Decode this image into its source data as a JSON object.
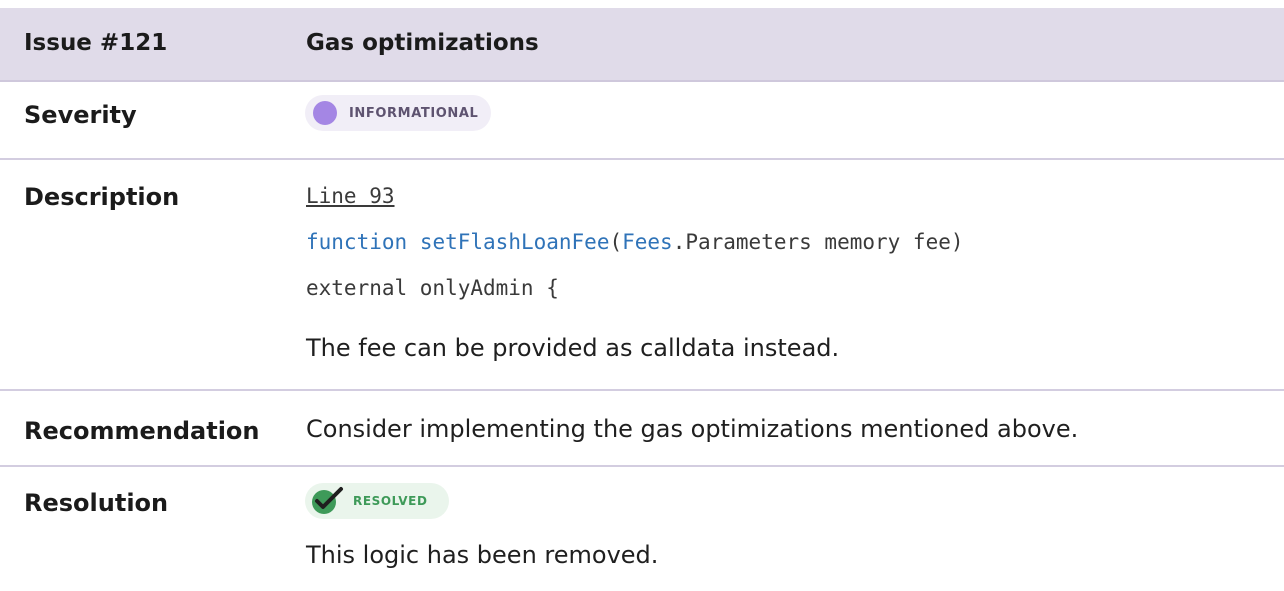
{
  "issue": {
    "number_label": "Issue #121",
    "title": "Gas optimizations"
  },
  "rows": {
    "severity": {
      "label": "Severity",
      "badge": "INFORMATIONAL",
      "badge_color": "#a486e4"
    },
    "description": {
      "label": "Description",
      "line_ref": "Line 93",
      "code_line1": {
        "keyword": "function",
        "space": " ",
        "name": "setFlashLoanFee",
        "open": "(",
        "type": "Fees",
        "rest": ".Parameters memory fee)"
      },
      "code_line2": "external onlyAdmin {",
      "text": "The fee can be provided as calldata instead."
    },
    "recommendation": {
      "label": "Recommendation",
      "text": "Consider implementing the gas optimizations mentioned above."
    },
    "resolution": {
      "label": "Resolution",
      "badge": "RESOLVED",
      "badge_color": "#3e9a59",
      "text": "This logic has been removed."
    }
  },
  "colors": {
    "header_bg": "#e0dbe9",
    "divider": "#d3cde0",
    "code_accent": "#2f73b8"
  },
  "icons": {
    "severity": "filled-circle",
    "resolution": "checkmark-badge-icon"
  }
}
